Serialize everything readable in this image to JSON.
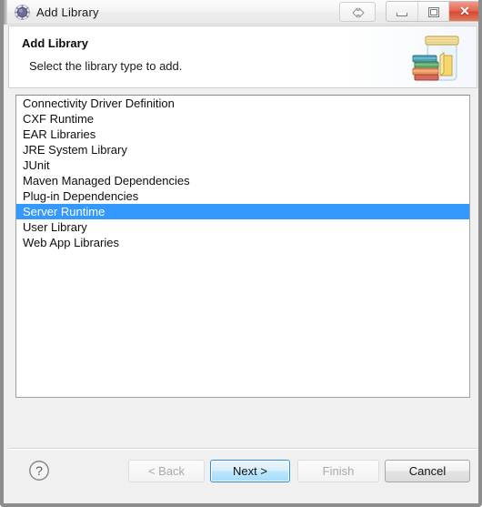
{
  "window": {
    "title": "Add Library",
    "app_icon": "eclipse-gear-icon",
    "controls": {
      "resize_label": "resize-handle",
      "minimize_glyph": "minimize-icon",
      "maximize_glyph": "restore-icon",
      "close_glyph": "✕"
    }
  },
  "header": {
    "title": "Add Library",
    "description": "Select the library type to add.",
    "icon": "library-jar-books-icon"
  },
  "list": {
    "name": "library-type-list",
    "selected_index": 7,
    "items": [
      {
        "label": "Connectivity Driver Definition",
        "selected": false
      },
      {
        "label": "CXF Runtime",
        "selected": false
      },
      {
        "label": "EAR Libraries",
        "selected": false
      },
      {
        "label": "JRE System Library",
        "selected": false
      },
      {
        "label": "JUnit",
        "selected": false
      },
      {
        "label": "Maven Managed Dependencies",
        "selected": false
      },
      {
        "label": "Plug-in Dependencies",
        "selected": false
      },
      {
        "label": "Server Runtime",
        "selected": true
      },
      {
        "label": "User Library",
        "selected": false
      },
      {
        "label": "Web App Libraries",
        "selected": false
      }
    ]
  },
  "buttons": {
    "help": "?",
    "back": "< Back",
    "next": "Next >",
    "finish": "Finish",
    "cancel": "Cancel"
  },
  "colors": {
    "selection_blue": "#3399ff",
    "default_button_border": "#2f90d8",
    "close_button_red": "#d8482f",
    "dialog_background": "#f0f0f0"
  }
}
